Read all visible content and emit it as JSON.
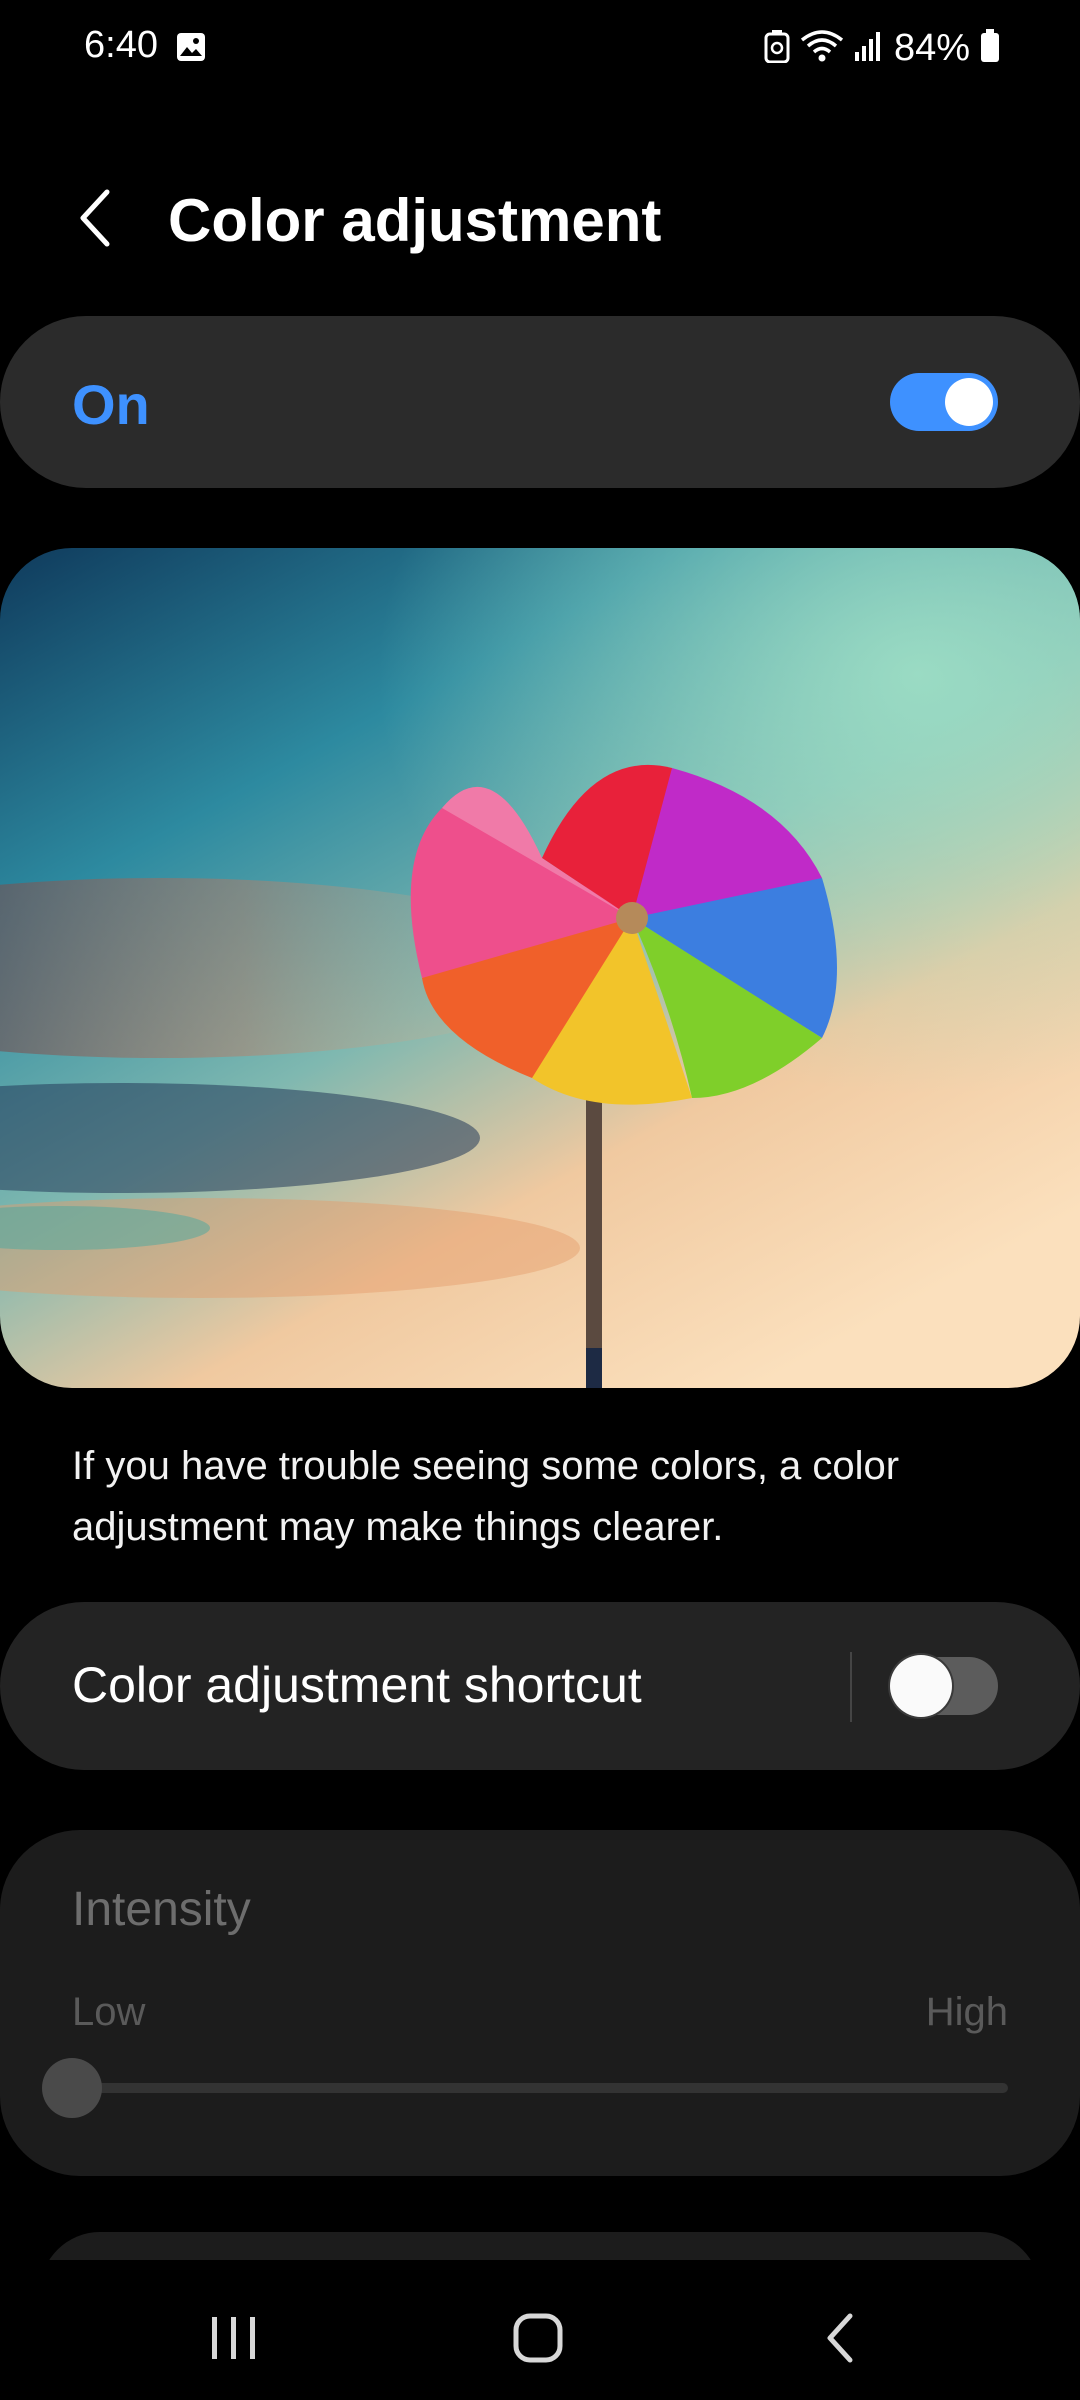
{
  "status_bar": {
    "time": "6:40",
    "battery_percent": "84%",
    "icons": [
      "image-icon",
      "battery-saver-icon",
      "wifi-icon",
      "signal-icon",
      "battery-icon"
    ]
  },
  "header": {
    "title": "Color adjustment",
    "back_icon": "back-chevron-icon"
  },
  "master_switch": {
    "label": "On",
    "checked": true,
    "accent_color": "#3e91ff"
  },
  "hero_image": {
    "subject": "pinwheel-photo"
  },
  "description": "If you have trouble seeing some colors, a color adjustment may make things clearer.",
  "shortcut": {
    "label": "Color adjustment shortcut",
    "checked": false
  },
  "intensity": {
    "title": "Intensity",
    "low_label": "Low",
    "high_label": "High",
    "value": 0,
    "enabled": false
  },
  "nav_bar": {
    "icons": [
      "recents-icon",
      "home-icon",
      "back-icon"
    ]
  }
}
